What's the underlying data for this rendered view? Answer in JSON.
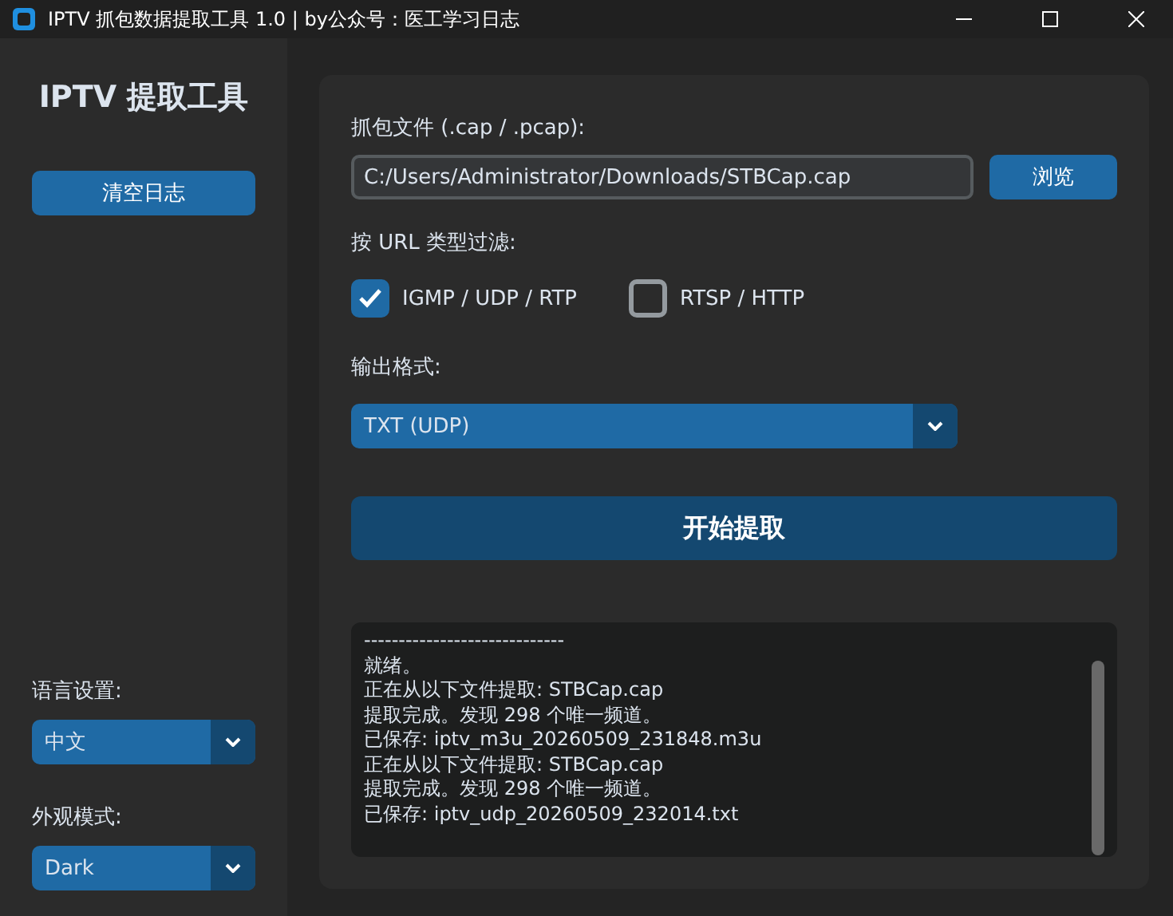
{
  "window": {
    "title": "IPTV 抓包数据提取工具 1.0 | by公众号：医工学习日志"
  },
  "sidebar": {
    "title": "IPTV 提取工具",
    "clear_button": "清空日志",
    "language": {
      "label": "语言设置:",
      "value": "中文"
    },
    "appearance": {
      "label": "外观模式:",
      "value": "Dark"
    }
  },
  "file": {
    "label": "抓包文件 (.cap / .pcap):",
    "value": "C:/Users/Administrator/Downloads/STBCap.cap",
    "browse_button": "浏览"
  },
  "filter": {
    "label": "按 URL 类型过滤:",
    "options": [
      {
        "label": "IGMP / UDP / RTP",
        "checked": true
      },
      {
        "label": "RTSP / HTTP",
        "checked": false
      }
    ]
  },
  "output": {
    "label": "输出格式:",
    "value": "TXT (UDP)"
  },
  "start_button": "开始提取",
  "log": [
    "-----------------------------",
    "就绪。",
    "正在从以下文件提取: STBCap.cap",
    "提取完成。发现 298 个唯一频道。",
    "已保存: iptv_m3u_20260509_231848.m3u",
    "正在从以下文件提取: STBCap.cap",
    "提取完成。发现 298 个唯一频道。",
    "已保存: iptv_udp_20260509_232014.txt"
  ]
}
